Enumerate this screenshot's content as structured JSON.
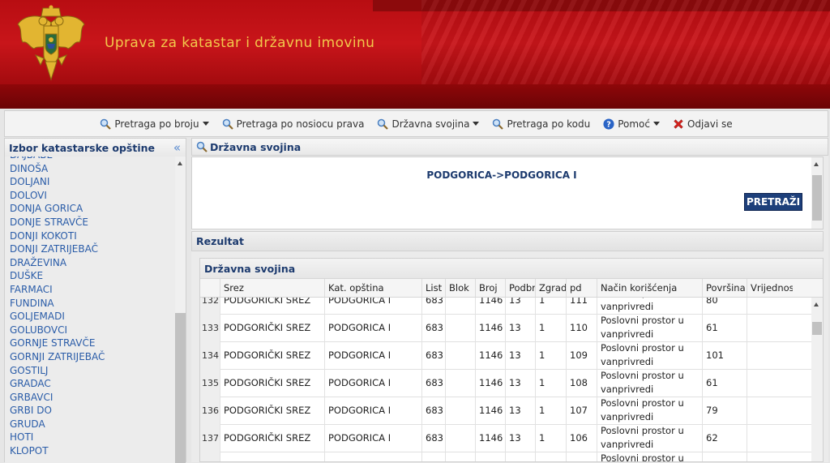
{
  "header": {
    "title": "Uprava za katastar i državnu imovinu"
  },
  "toolbar": {
    "items": [
      {
        "label": "Pretraga po broju",
        "icon": "magnifier-icon",
        "dropdown": true
      },
      {
        "label": "Pretraga po nosiocu prava",
        "icon": "magnifier-icon",
        "dropdown": false
      },
      {
        "label": "Državna svojina",
        "icon": "magnifier-icon",
        "dropdown": true
      },
      {
        "label": "Pretraga po kodu",
        "icon": "magnifier-icon",
        "dropdown": false
      },
      {
        "label": "Pomoć",
        "icon": "help-icon",
        "dropdown": true
      },
      {
        "label": "Odjavi se",
        "icon": "logout-x-icon",
        "dropdown": false
      }
    ]
  },
  "sidebar": {
    "title": "Izbor katastarske opštine",
    "collapse_glyph": "«",
    "items": [
      "DAJBABE",
      "DINOŠA",
      "DOLJANI",
      "DOLOVI",
      "DONJA GORICA",
      "DONJE STRAVČE",
      "DONJI KOKOTI",
      "DONJI ZATRIJEBAČ",
      "DRAŽEVINA",
      "DUŠKE",
      "FARMACI",
      "FUNDINA",
      "GOLJEMADI",
      "GOLUBOVCI",
      "GORNJE STRAVČE",
      "GORNJI ZATRIJEBAČ",
      "GOSTILJ",
      "GRADAC",
      "GRBAVCI",
      "GRBI DO",
      "GRUDA",
      "HOTI",
      "KLOPOT"
    ]
  },
  "main": {
    "panel_title": "Državna svojina",
    "path": "PODGORICA->PODGORICA I",
    "search_button": "PRETRAŽI",
    "results_title": "Rezultat",
    "results_grid_title": "Državna svojina",
    "columns": [
      "Srez",
      "Kat. opština",
      "List",
      "Blok",
      "Broj",
      "Podbroj",
      "Zgrada",
      "pd",
      "Način korišćenja",
      "Površina",
      "Vrijednost"
    ],
    "rows": [
      {
        "n": "132",
        "srez": "PODGORICKI SREZ",
        "opstina": "PODGORICA I",
        "list": "683",
        "blok": "",
        "broj": "1146",
        "podbroj": "13",
        "zgrada": "1",
        "pd": "111",
        "nacin": "Poslovni prostor u vanprivredi",
        "povrsina": "80",
        "vrijednost": ""
      },
      {
        "n": "133",
        "srez": "PODGORIČKI SREZ",
        "opstina": "PODGORICA I",
        "list": "683",
        "blok": "",
        "broj": "1146",
        "podbroj": "13",
        "zgrada": "1",
        "pd": "110",
        "nacin": "Poslovni prostor u vanprivredi",
        "povrsina": "61",
        "vrijednost": ""
      },
      {
        "n": "134",
        "srez": "PODGORIČKI SREZ",
        "opstina": "PODGORICA I",
        "list": "683",
        "blok": "",
        "broj": "1146",
        "podbroj": "13",
        "zgrada": "1",
        "pd": "109",
        "nacin": "Poslovni prostor u vanprivredi",
        "povrsina": "101",
        "vrijednost": ""
      },
      {
        "n": "135",
        "srez": "PODGORIČKI SREZ",
        "opstina": "PODGORICA I",
        "list": "683",
        "blok": "",
        "broj": "1146",
        "podbroj": "13",
        "zgrada": "1",
        "pd": "108",
        "nacin": "Poslovni prostor u vanprivredi",
        "povrsina": "61",
        "vrijednost": ""
      },
      {
        "n": "136",
        "srez": "PODGORIČKI SREZ",
        "opstina": "PODGORICA I",
        "list": "683",
        "blok": "",
        "broj": "1146",
        "podbroj": "13",
        "zgrada": "1",
        "pd": "107",
        "nacin": "Poslovni prostor u vanprivredi",
        "povrsina": "79",
        "vrijednost": ""
      },
      {
        "n": "137",
        "srez": "PODGORIČKI SREZ",
        "opstina": "PODGORICA I",
        "list": "683",
        "blok": "",
        "broj": "1146",
        "podbroj": "13",
        "zgrada": "1",
        "pd": "106",
        "nacin": "Poslovni prostor u vanprivredi",
        "povrsina": "62",
        "vrijednost": ""
      },
      {
        "n": "",
        "srez": "",
        "opstina": "",
        "list": "",
        "blok": "",
        "broj": "",
        "podbroj": "",
        "zgrada": "",
        "pd": "",
        "nacin": "Poslovni prostor u",
        "povrsina": "",
        "vrijednost": ""
      }
    ]
  },
  "colors": {
    "header_red": "#c8151a",
    "title_gold": "#f2c84b",
    "link_blue": "#2a5ca8",
    "heading_navy": "#1c3a6e",
    "button_navy": "#1d3f7a"
  }
}
